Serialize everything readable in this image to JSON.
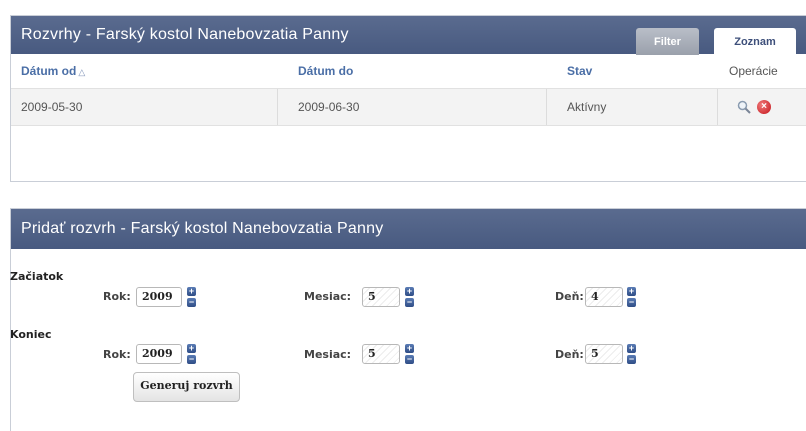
{
  "list_panel": {
    "title": "Rozvrhy - Farský kostol Nanebovzatia Panny",
    "tabs": [
      {
        "label": "Filter"
      },
      {
        "label": "Zoznam"
      }
    ],
    "columns": [
      {
        "label": "Dátum od",
        "sort_icon": "sort-ascending-icon"
      },
      {
        "label": "Dátum do"
      },
      {
        "label": "Stav"
      },
      {
        "label": "Operácie"
      }
    ],
    "rows": [
      {
        "date_from": "2009-05-30",
        "date_to": "2009-06-30",
        "status": "Aktívny",
        "actions": [
          "search-icon",
          "delete-icon"
        ]
      }
    ]
  },
  "add_panel": {
    "title": "Pridať rozvrh - Farský kostol Nanebovzatia Panny",
    "start": {
      "label": "Začiatok",
      "year_label": "Rok:",
      "year": "2009",
      "month_label": "Mesiac:",
      "month": "5",
      "day_label": "Deň:",
      "day": "4"
    },
    "end": {
      "label": "Koniec",
      "year_label": "Rok:",
      "year": "2009",
      "month_label": "Mesiac:",
      "month": "5",
      "day_label": "Deň:",
      "day": "5"
    },
    "generate_label": "Generuj rozvrh"
  },
  "colors": {
    "header": "#4f6187",
    "link": "#4a6ea6",
    "delete": "#c4141b"
  }
}
